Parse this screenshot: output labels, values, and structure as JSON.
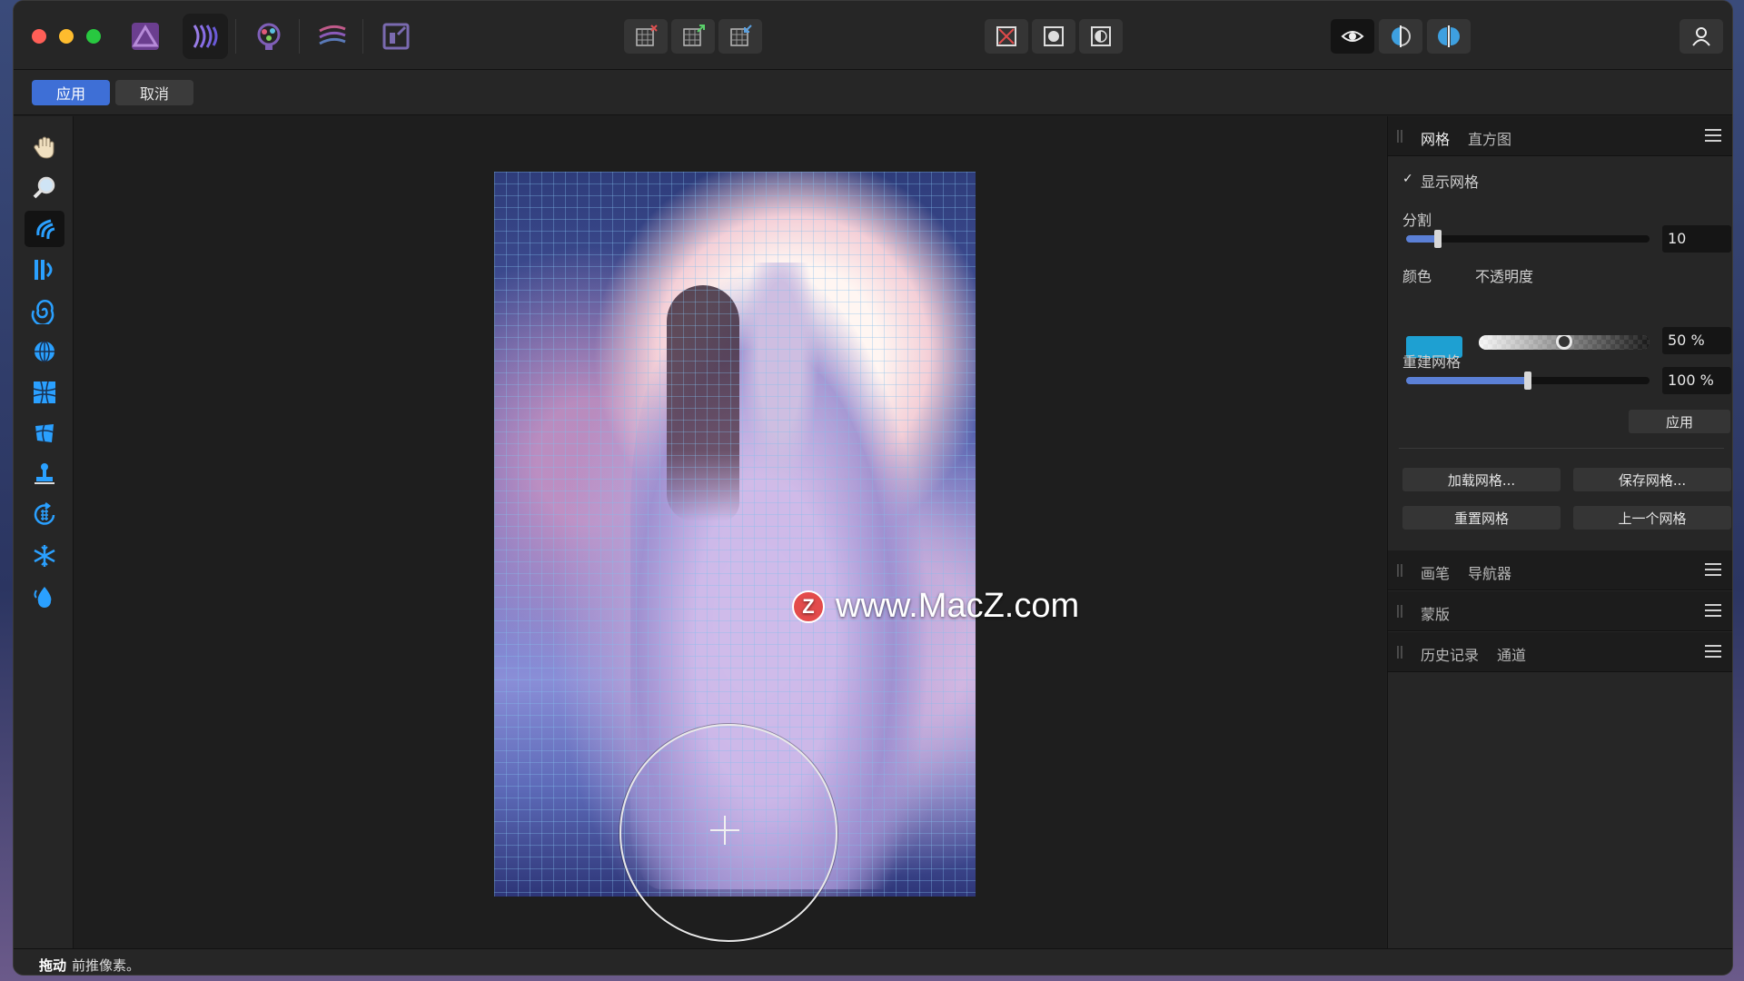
{
  "app": {
    "personas": [
      {
        "name": "photo-persona-icon"
      },
      {
        "name": "liquify-persona-icon"
      },
      {
        "name": "develop-persona-icon"
      },
      {
        "name": "tone-mapping-persona-icon"
      },
      {
        "name": "export-persona-icon"
      }
    ],
    "toolbar_groups": {
      "mesh": [
        "clear-mesh-icon",
        "freeze-mesh-icon",
        "thaw-mesh-icon"
      ],
      "mask": [
        "clear-mask-icon",
        "show-mask-icon",
        "invert-mask-icon"
      ],
      "view": [
        "view-mode-icon",
        "split-view-icon",
        "mirror-view-icon"
      ]
    },
    "account_icon": "user-icon"
  },
  "actionbar": {
    "apply_label": "应用",
    "cancel_label": "取消"
  },
  "tools": [
    {
      "name": "hand-tool",
      "icon": "hand-icon"
    },
    {
      "name": "zoom-tool",
      "icon": "magnifier-icon"
    },
    {
      "name": "push-forward-tool",
      "icon": "push-forward-icon",
      "active": true
    },
    {
      "name": "push-left-tool",
      "icon": "push-left-icon"
    },
    {
      "name": "twirl-tool",
      "icon": "twirl-icon"
    },
    {
      "name": "pinch-tool",
      "icon": "pinch-icon"
    },
    {
      "name": "punch-tool",
      "icon": "punch-icon"
    },
    {
      "name": "turbulence-tool",
      "icon": "turbulence-icon"
    },
    {
      "name": "clone-tool",
      "icon": "clone-stamp-icon"
    },
    {
      "name": "reconstruct-tool",
      "icon": "reconstruct-icon"
    },
    {
      "name": "freeze-tool",
      "icon": "snowflake-icon"
    },
    {
      "name": "thaw-tool",
      "icon": "thaw-drop-icon"
    }
  ],
  "canvas": {
    "watermark_text": "www.MacZ.com",
    "watermark_logo": "Z"
  },
  "panel": {
    "mesh_tab": "网格",
    "histogram_tab": "直方图",
    "show_mesh_label": "显示网格",
    "show_mesh_checked": true,
    "divisions_label": "分割",
    "divisions_value": "10",
    "divisions_fraction": 0.13,
    "color_label": "颜色",
    "color_value": "#1ea0d2",
    "opacity_label": "不透明度",
    "opacity_value": "50 %",
    "opacity_fraction": 0.5,
    "rebuild_label": "重建网格",
    "rebuild_value": "100 %",
    "rebuild_fraction": 0.5,
    "rebuild_apply": "应用",
    "load_mesh": "加载网格...",
    "save_mesh": "保存网格...",
    "reset_mesh": "重置网格",
    "previous_mesh": "上一个网格",
    "brush_tab": "画笔",
    "navigator_tab": "导航器",
    "mask_tab": "蒙版",
    "history_tab": "历史记录",
    "channels_tab": "通道"
  },
  "status": {
    "action": "拖动",
    "hint": "前推像素。"
  }
}
